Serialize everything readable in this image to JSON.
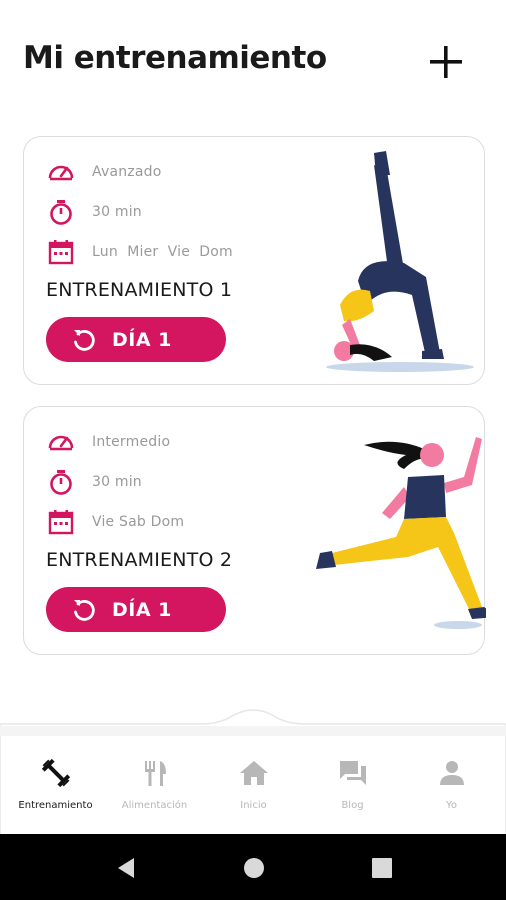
{
  "header": {
    "title": "Mi entrenamiento",
    "add_icon": "plus-icon"
  },
  "colors": {
    "accent": "#d4155f",
    "muted_text": "#9a9a9a",
    "navy": "#27345e",
    "yellow": "#f5c518",
    "pink_skin": "#f37aa0"
  },
  "workouts": [
    {
      "level": "Avanzado",
      "duration": "30 min",
      "days": "Lun  Mier  Vie  Dom",
      "name": "ENTRENAMIENTO 1",
      "button_label": "DÍA 1"
    },
    {
      "level": "Intermedio",
      "duration": "30 min",
      "days": "Vie Sab Dom",
      "name": "ENTRENAMIENTO 2",
      "button_label": "DÍA 1"
    }
  ],
  "nav": {
    "items": [
      {
        "label": "Entrenamiento",
        "icon": "dumbbell-icon",
        "active": true
      },
      {
        "label": "Alimentación",
        "icon": "fork-knife-icon",
        "active": false
      },
      {
        "label": "Inicio",
        "icon": "home-icon",
        "active": false
      },
      {
        "label": "Blog",
        "icon": "chat-icon",
        "active": false
      },
      {
        "label": "Yo",
        "icon": "person-icon",
        "active": false
      }
    ]
  },
  "system": {
    "buttons": [
      "back-icon",
      "home-circle-icon",
      "recents-icon"
    ]
  }
}
